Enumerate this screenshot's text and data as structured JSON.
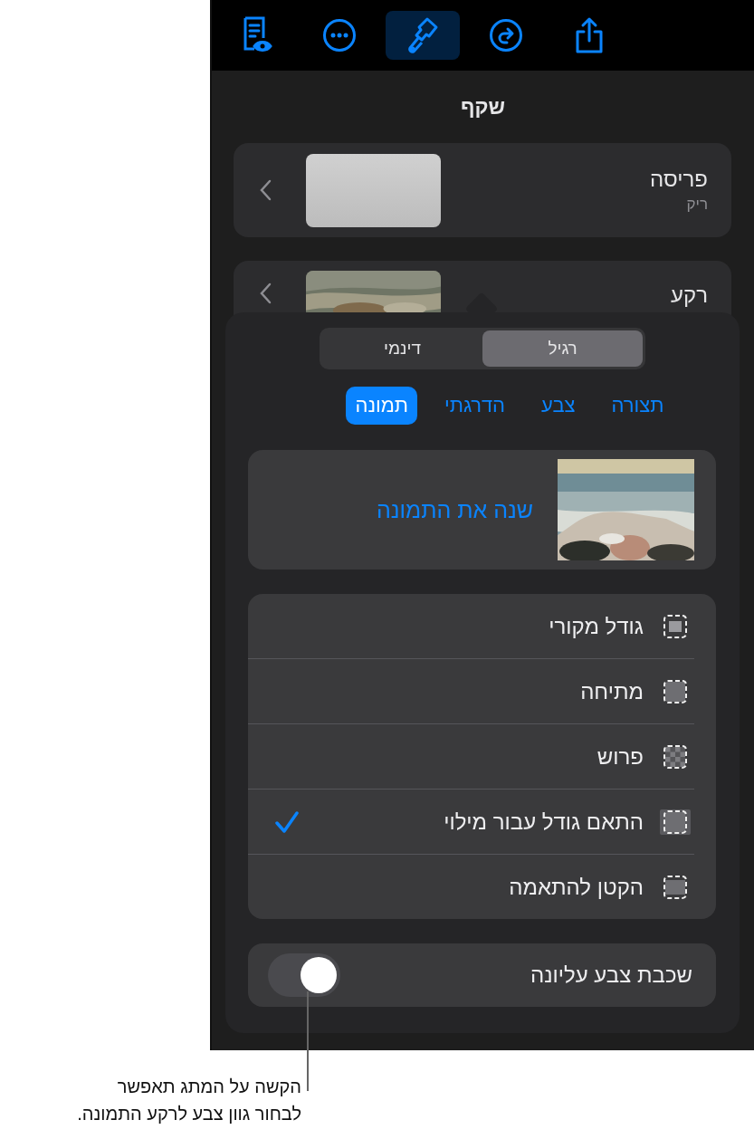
{
  "toolbar": [
    {
      "kind": "preview",
      "selected": false
    },
    {
      "kind": "more",
      "selected": false
    },
    {
      "kind": "format",
      "selected": true
    },
    {
      "kind": "redo",
      "selected": false
    },
    {
      "kind": "share",
      "selected": false
    }
  ],
  "title": "שקף",
  "layout": {
    "label": "פריסה",
    "value": "ריק"
  },
  "background": {
    "label": "רקע"
  },
  "segments": [
    {
      "label": "רגיל",
      "selected": true
    },
    {
      "label": "דינמי",
      "selected": false
    }
  ],
  "tabs": [
    {
      "label": "תצורה",
      "selected": false
    },
    {
      "label": "צבע",
      "selected": false
    },
    {
      "label": "הדרגתי",
      "selected": false
    },
    {
      "label": "תמונה",
      "selected": true
    }
  ],
  "change_image": "שנה את התמונה",
  "scale_options": [
    {
      "kind": "original",
      "label": "גודל מקורי",
      "selected": false
    },
    {
      "kind": "stretch",
      "label": "מתיחה",
      "selected": false
    },
    {
      "kind": "tile",
      "label": "פרוש",
      "selected": false
    },
    {
      "kind": "fill",
      "label": "התאם גודל עבור מילוי",
      "selected": true
    },
    {
      "kind": "fit",
      "label": "הקטן להתאמה",
      "selected": false
    }
  ],
  "color_overlay": {
    "label": "שכבת צבע עליונה",
    "on": false
  },
  "callout": "הקשה על המתג תאפשר\nלבחור גוון צבע לרקע התמונה."
}
